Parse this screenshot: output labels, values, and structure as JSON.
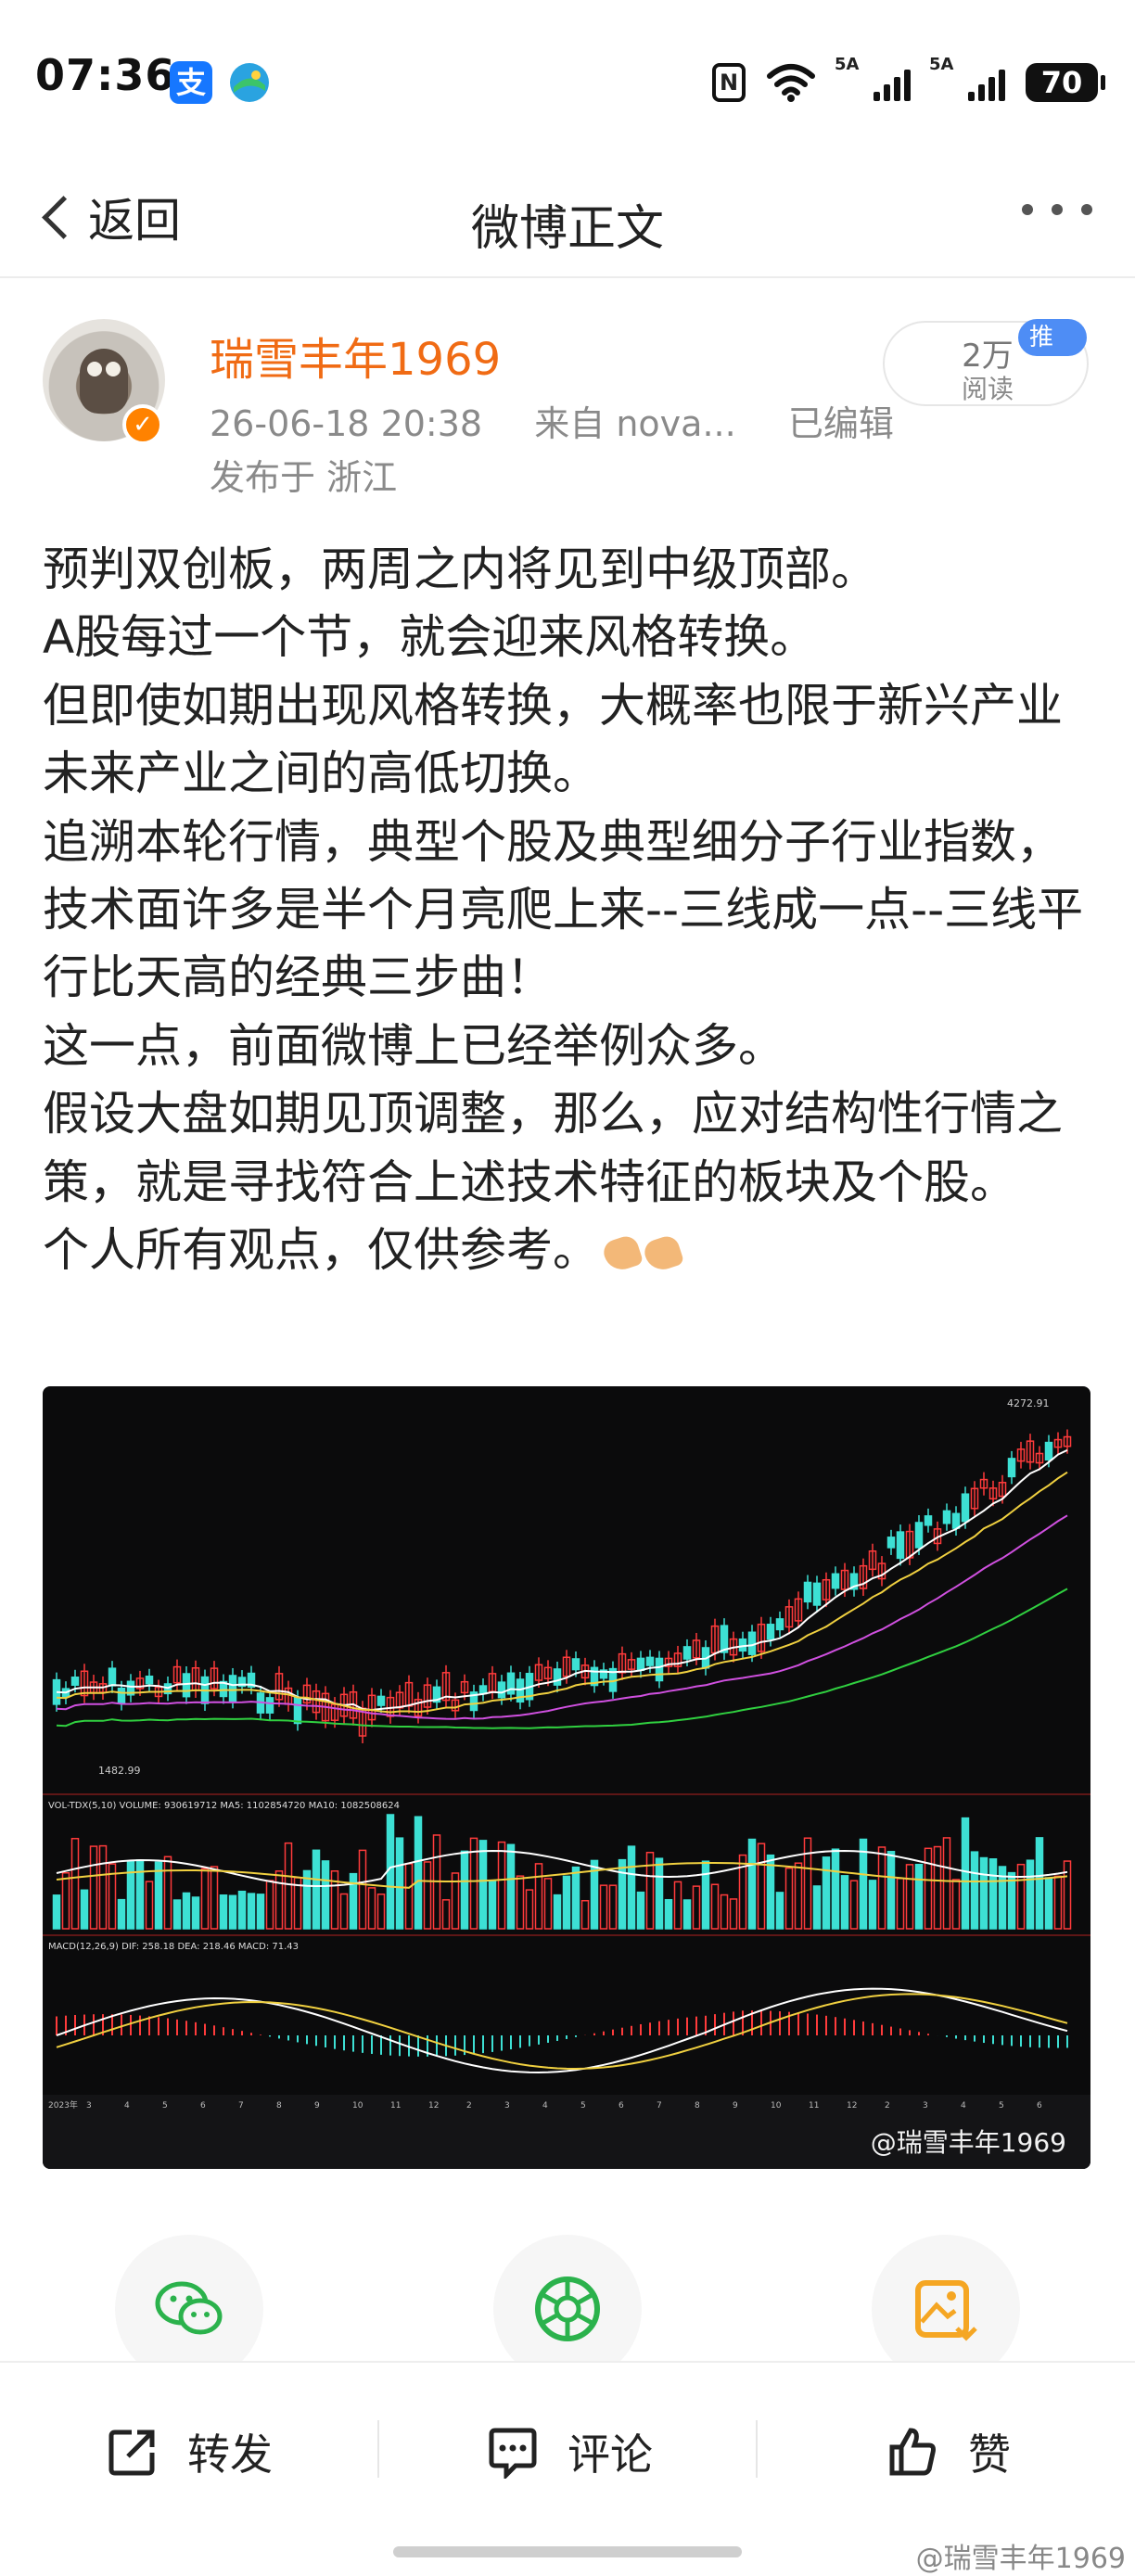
{
  "status_bar": {
    "time": "07:36",
    "alipay_icon_text": "支",
    "signal1_label": "5A",
    "signal2_label": "5A",
    "battery": "70",
    "nfc_label": "N"
  },
  "nav": {
    "back_label": "返回",
    "title": "微博正文"
  },
  "author": {
    "name": "瑞雪丰年1969",
    "date": "26-06-18 20:38",
    "source": "来自 nova...",
    "edited": "已编辑",
    "location": "发布于 浙江",
    "views_count": "2万",
    "views_label": "阅读",
    "promo_label": "推广"
  },
  "post": {
    "lines": [
      "预判双创板，两周之内将见到中级顶部。",
      "A股每过一个节，就会迎来风格转换。",
      "但即使如期出现风格转换，大概率也限于新兴产业未来产业之间的高低切换。",
      "追溯本轮行情，典型个股及典型细分子行业指数，技术面许多是半个月亮爬上来--三线成一点--三线平行比天高的经典三步曲！",
      "这一点，前面微博上已经举例众多。",
      "假设大盘如期见顶调整，那么，应对结构性行情之策，就是寻找符合上述技术特征的板块及个股。",
      "个人所有观点，仅供参考。"
    ]
  },
  "chart_image": {
    "low_label": "1482.99",
    "high_label": "4272.91",
    "volume_header": "VOL-TDX(5,10) VOLUME: 930619712  MA5: 1102854720  MA10: 1082508624",
    "macd_header": "MACD(12,26,9) DIF: 258.18  DEA: 218.46  MACD: 71.43",
    "month_labels": [
      "2023年",
      "3",
      "4",
      "5",
      "6",
      "7",
      "8",
      "9",
      "10",
      "11",
      "12",
      "2",
      "3",
      "4",
      "5",
      "6",
      "7",
      "8",
      "9",
      "10",
      "11",
      "12",
      "2",
      "3",
      "4",
      "5",
      "6"
    ],
    "watermark": "@瑞雪丰年1969"
  },
  "share": {
    "wechat_icon": "wechat-icon",
    "moments_icon": "wechat-moments-icon",
    "save_image_icon": "save-image-icon"
  },
  "actions": {
    "repost": "转发",
    "comment": "评论",
    "like": "赞"
  },
  "page_watermark": "@瑞雪丰年1969",
  "colors": {
    "brand_orange": "#f06b14",
    "promo_blue": "#4e8df5",
    "wechat_green": "#2bb24c",
    "save_orange": "#f5a623"
  }
}
